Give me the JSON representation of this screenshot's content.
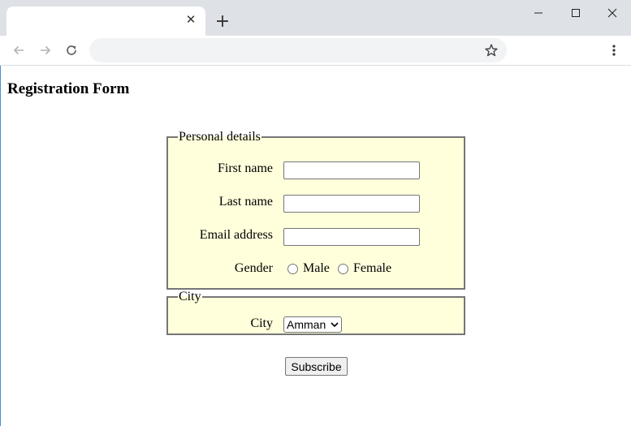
{
  "browser": {
    "tab_close_glyph": "✕",
    "new_tab_glyph": "+",
    "icons": [
      "close-icon",
      "plus-icon",
      "minimize-icon",
      "maximize-icon",
      "window-close-icon",
      "back-arrow-icon",
      "forward-arrow-icon",
      "reload-icon",
      "star-icon",
      "kebab-menu-icon"
    ]
  },
  "page": {
    "title": "Registration Form"
  },
  "personal": {
    "legend": "Personal details",
    "first_name_label": "First name",
    "first_name_value": "",
    "last_name_label": "Last name",
    "last_name_value": "",
    "email_label": "Email address",
    "email_value": "",
    "gender_label": "Gender",
    "gender_options": [
      "Male",
      "Female"
    ]
  },
  "city_section": {
    "legend": "City",
    "city_label": "City",
    "city_selected": "Amman"
  },
  "actions": {
    "subscribe_label": "Subscribe"
  },
  "colors": {
    "fieldset_background": "#ffffdc",
    "fieldset_border": "#767676",
    "chrome_background": "#dee1e6"
  }
}
